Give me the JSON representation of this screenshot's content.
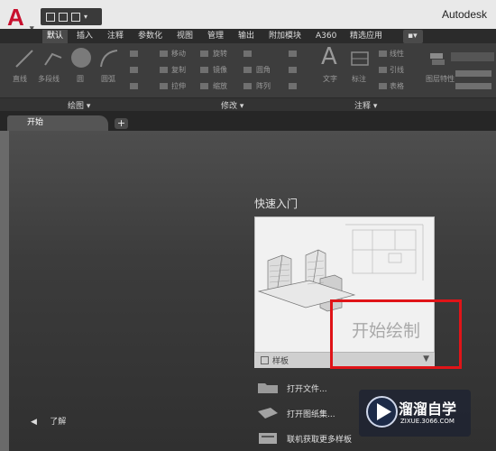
{
  "app": {
    "logo_letter": "A",
    "title": "Autodesk"
  },
  "ribbon": {
    "tabs": [
      "默认",
      "插入",
      "注释",
      "参数化",
      "视图",
      "管理",
      "输出",
      "附加模块",
      "A360",
      "精选应用"
    ],
    "active_tab": "默认",
    "panels": [
      "绘图 ▾",
      "修改 ▾",
      "注释 ▾"
    ],
    "tools": {
      "line": "直线",
      "polyline": "多段线",
      "circle": "圆",
      "arc": "圆弧",
      "move": "移动",
      "rotate": "旋转",
      "copy": "复制",
      "mirror": "镜像",
      "stretch": "拉伸",
      "scale": "缩放",
      "fillet": "圆角",
      "array": "阵列",
      "text": "文字",
      "dimension": "标注",
      "linear": "线性",
      "leader": "引线",
      "table": "表格",
      "layer_props": "图层特性"
    }
  },
  "file_tabs": {
    "start": "开始",
    "add": "+"
  },
  "start_page": {
    "quick_start_title": "快速入门",
    "start_drawing": "开始绘制",
    "template_label": "样板",
    "template_dropdown": "▼",
    "links": [
      {
        "label": "打开文件...",
        "icon": "open-folder-icon"
      },
      {
        "label": "打开图纸集...",
        "icon": "sheet-set-icon"
      },
      {
        "label": "联机获取更多样板",
        "icon": "online-templates-icon"
      }
    ],
    "learn": "了解",
    "learn_arrow": "◀"
  },
  "watermark": {
    "title": "溜溜自学",
    "subtitle": "ZIXUE.3066.COM"
  },
  "colors": {
    "highlight": "#e01418",
    "logo": "#c8102e"
  }
}
